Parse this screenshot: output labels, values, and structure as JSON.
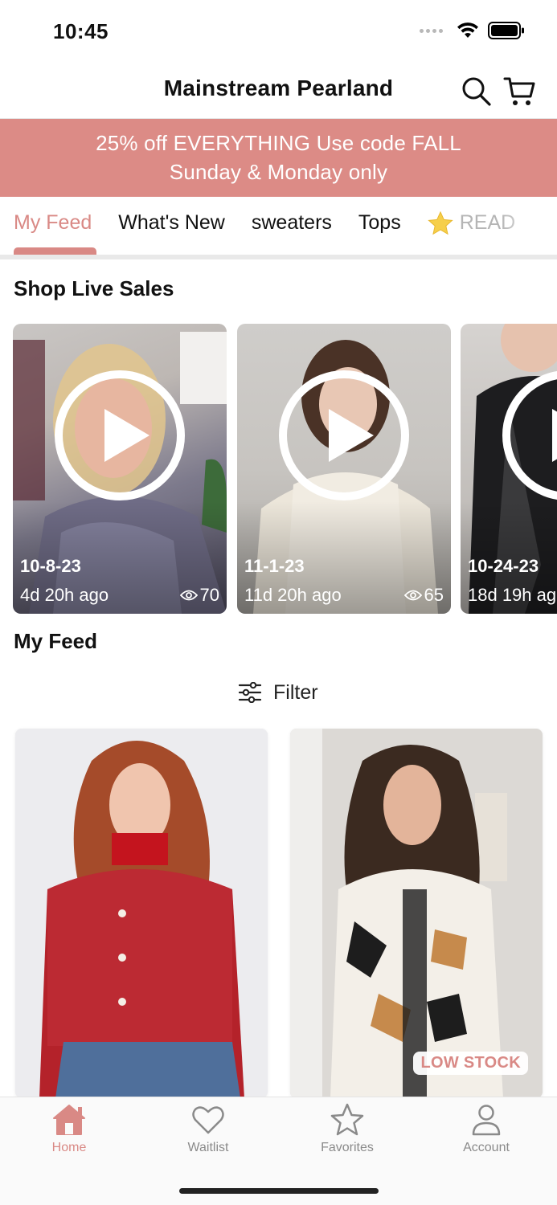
{
  "status_bar": {
    "time": "10:45"
  },
  "header": {
    "title": "Mainstream Pearland",
    "search_icon": "search-icon",
    "cart_icon": "cart-icon"
  },
  "promo": {
    "line1": "25% off EVERYTHING Use code FALL",
    "line2": "Sunday & Monday only",
    "color": "#dc8b86"
  },
  "tabs": [
    {
      "label": "My Feed",
      "active": true
    },
    {
      "label": "What's New"
    },
    {
      "label": "sweaters"
    },
    {
      "label": "Tops"
    },
    {
      "label": "READ",
      "icon": "star-icon"
    }
  ],
  "live_sales": {
    "title": "Shop Live Sales",
    "items": [
      {
        "date": "10-8-23",
        "ago": "4d 20h ago",
        "views": "70"
      },
      {
        "date": "11-1-23",
        "ago": "11d 20h ago",
        "views": "65"
      },
      {
        "date": "10-24-23",
        "ago": "18d 19h ag"
      }
    ]
  },
  "feed": {
    "title": "My Feed",
    "filter_label": "Filter",
    "products": [
      {
        "badge": ""
      },
      {
        "badge": "LOW STOCK"
      }
    ]
  },
  "bottom_nav": [
    {
      "label": "Home",
      "icon": "home-icon",
      "active": true
    },
    {
      "label": "Waitlist",
      "icon": "heart-icon"
    },
    {
      "label": "Favorites",
      "icon": "star-icon"
    },
    {
      "label": "Account",
      "icon": "user-icon"
    }
  ],
  "colors": {
    "accent": "#d98985",
    "promo": "#dc8b86"
  }
}
